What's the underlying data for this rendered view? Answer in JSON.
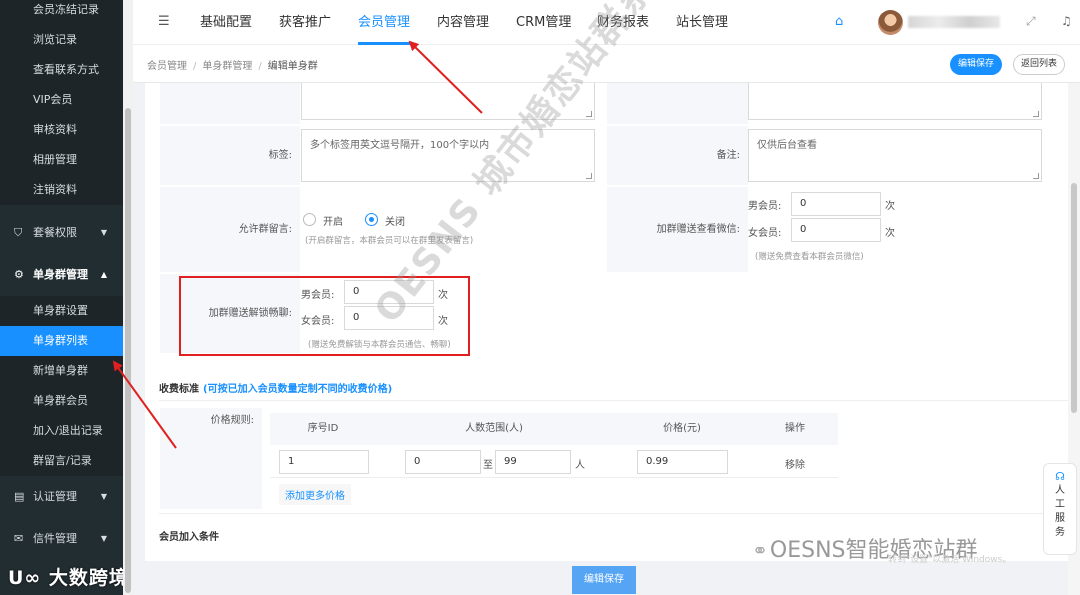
{
  "sidebar": {
    "items_top": [
      "会员冻结记录",
      "浏览记录",
      "查看联系方式",
      "VIP会员",
      "审核资料",
      "相册管理",
      "注销资料"
    ],
    "group_package": "套餐权限",
    "group_single": "单身群管理",
    "items_single": [
      "单身群设置",
      "单身群列表",
      "新增单身群",
      "单身群会员",
      "加入/退出记录",
      "群留言/记录"
    ],
    "group_auth": "认证管理",
    "group_mail": "信件管理",
    "bottom_logo": "大数跨境"
  },
  "topnav": {
    "tabs": [
      "基础配置",
      "获客推广",
      "会员管理",
      "内容管理",
      "CRM管理",
      "财务报表",
      "站长管理"
    ],
    "active_tab": "会员管理"
  },
  "breadcrumb": {
    "level1": "会员管理",
    "level2": "单身群管理",
    "current": "编辑单身群"
  },
  "buttons": {
    "save_top": "编辑保存",
    "back": "返回列表",
    "save_bottom": "编辑保存",
    "add_price": "添加更多价格"
  },
  "form": {
    "tags_label": "标签:",
    "tags_placeholder": "多个标签用英文逗号隔开，100个字以内",
    "remark_label": "备注:",
    "remark_placeholder": "仅供后台查看",
    "allow_msg_label": "允许群留言:",
    "allow_msg_on": "开启",
    "allow_msg_off": "关闭",
    "allow_msg_hint": "(开启群留言，本群会员可以在群里发表留言)",
    "wechat_label": "加群赠送查看微信:",
    "wechat_male_label": "男会员:",
    "wechat_male_value": "0",
    "wechat_female_label": "女会员:",
    "wechat_female_value": "0",
    "wechat_unit": "次",
    "wechat_hint": "(赠送免费查看本群会员微信)",
    "unlock_label": "加群赠送解锁畅聊:",
    "unlock_male_label": "男会员:",
    "unlock_male_value": "0",
    "unlock_female_label": "女会员:",
    "unlock_female_value": "0",
    "unlock_unit": "次",
    "unlock_hint": "(赠送免费解锁与本群会员通信、畅聊)"
  },
  "fee": {
    "title": "收费标准",
    "note": "(可按已加入会员数量定制不同的收费价格)",
    "rule_label": "价格规则:",
    "headers": [
      "序号ID",
      "人数范围(人)",
      "价格(元)",
      "操作"
    ],
    "row": {
      "id": "1",
      "min": "0",
      "to": "至",
      "max": "99",
      "unit": "人",
      "price": "0.99",
      "action": "移除"
    }
  },
  "join_condition_title": "会员加入条件",
  "customer_service": [
    "人",
    "工",
    "服",
    "务"
  ],
  "watermark": "OESNS 城市婚恋站群系统",
  "watermark2": "OESNS智能婚恋站群",
  "activate_text": "转到\"设置\"以激活 Windows。",
  "colors": {
    "primary": "#1890ff",
    "sidebar": "#222d32",
    "highlight": "#e02020"
  }
}
